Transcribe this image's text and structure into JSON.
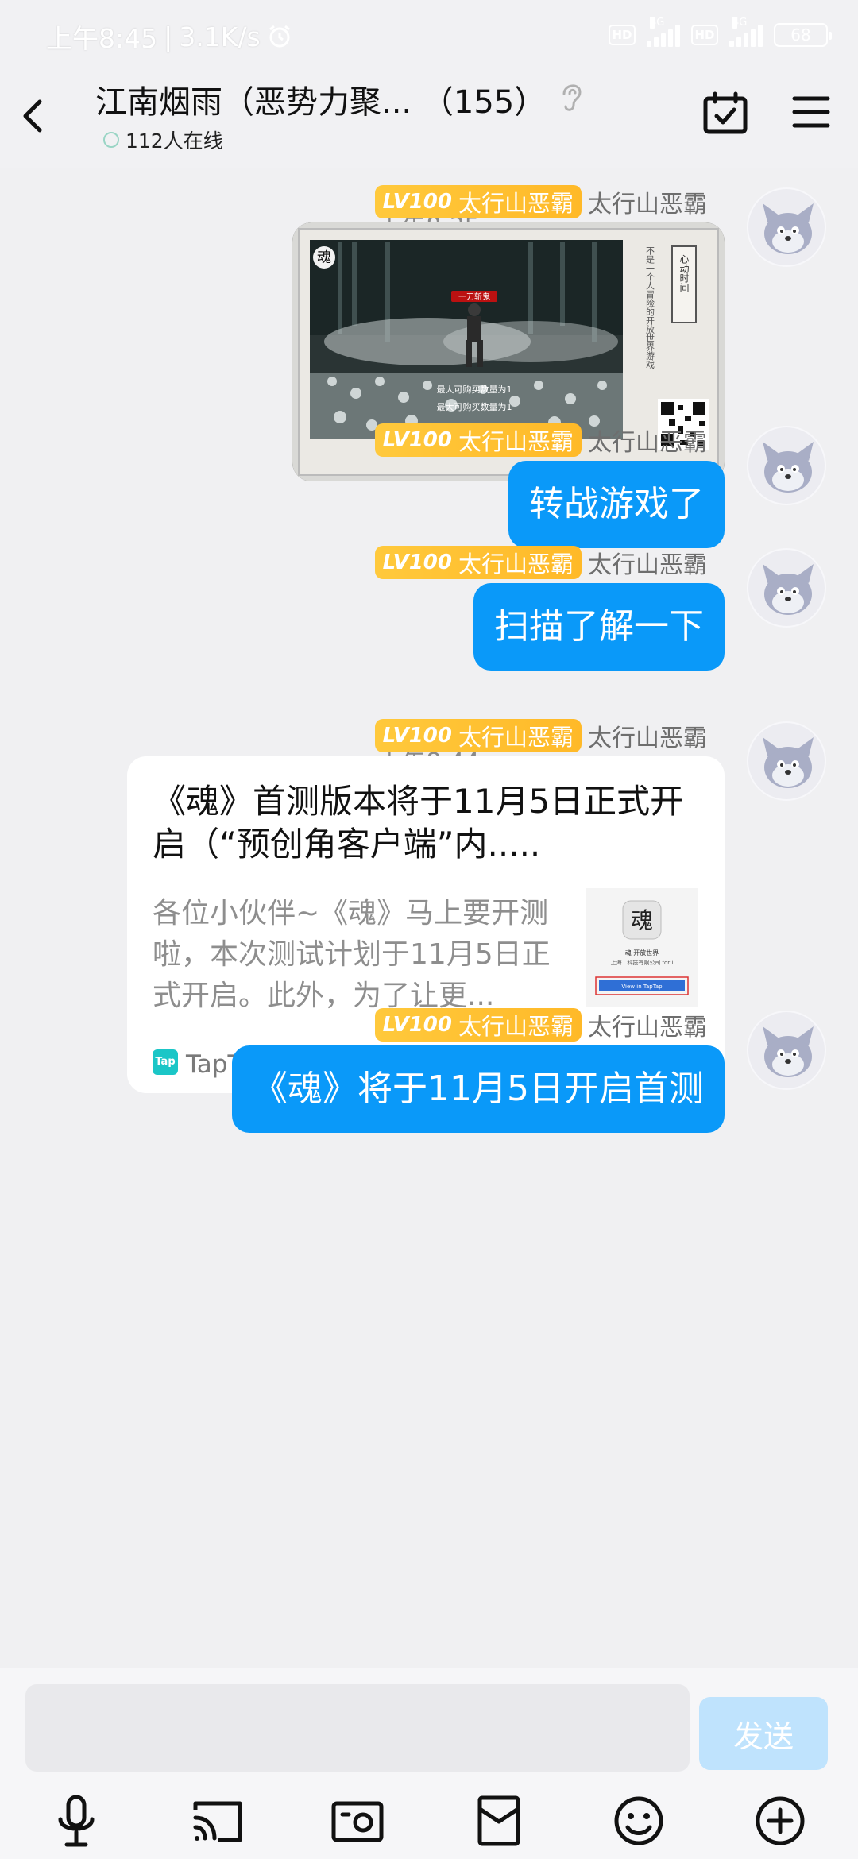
{
  "status_bar": {
    "time": "上午8:45",
    "speed": "3.1K/s",
    "hd1": "HD",
    "net1": "4G",
    "hd2": "HD",
    "net2": "4G",
    "battery": "68"
  },
  "header": {
    "title": "江南烟雨（恶势力聚...",
    "member_count": "（155）",
    "online": "112人在线"
  },
  "messages": [
    {
      "type": "time",
      "text": "上午8:35"
    },
    {
      "type": "image",
      "badge_level": "LV100",
      "badge_title": "太行山恶霸",
      "sender": "太行山恶霸",
      "image": {
        "logo": "魂",
        "tag": "一刀斩鬼",
        "side_text": "不是一个人冒险的开放世界游戏",
        "side_title": "心动时间",
        "caption1": "最大可购买数量为1",
        "caption2": "最大可购买数量为1"
      }
    },
    {
      "type": "text",
      "badge_level": "LV100",
      "badge_title": "太行山恶霸",
      "sender": "太行山恶霸",
      "text": "转战游戏了"
    },
    {
      "type": "text",
      "badge_level": "LV100",
      "badge_title": "太行山恶霸",
      "sender": "太行山恶霸",
      "text": "扫描了解一下"
    },
    {
      "type": "time",
      "text": "上午8:44"
    },
    {
      "type": "link",
      "badge_level": "LV100",
      "badge_title": "太行山恶霸",
      "sender": "太行山恶霸",
      "card": {
        "title": "《魂》首测版本将于11月5日正式开启（“预创角客户端”内.....",
        "desc": "各位小伙伴~《魂》马上要开测啦，本次测试计划于11月5日正式开启。此外，为了让更...",
        "thumb_logo": "魂",
        "thumb_line1": "魂 开放世界",
        "thumb_line2": "上海...科技有限公司 for i",
        "thumb_button": "View in TapTap",
        "source_logo": "Tap",
        "source": "TapTap 发现好游戏"
      }
    },
    {
      "type": "text",
      "badge_level": "LV100",
      "badge_title": "太行山恶霸",
      "sender": "太行山恶霸",
      "text": "《魂》将于11月5日开启首测"
    }
  ],
  "input": {
    "value": "",
    "send_label": "发送"
  },
  "colors": {
    "bubble": "#0a99f9",
    "badge": "#ffc93c",
    "send_disabled": "#bfe3fd",
    "tap_logo": "#1bc6c7"
  },
  "toolbar_icons": [
    "microphone-icon",
    "cast-icon",
    "camera-icon",
    "red-packet-icon",
    "emoji-icon",
    "plus-icon"
  ]
}
